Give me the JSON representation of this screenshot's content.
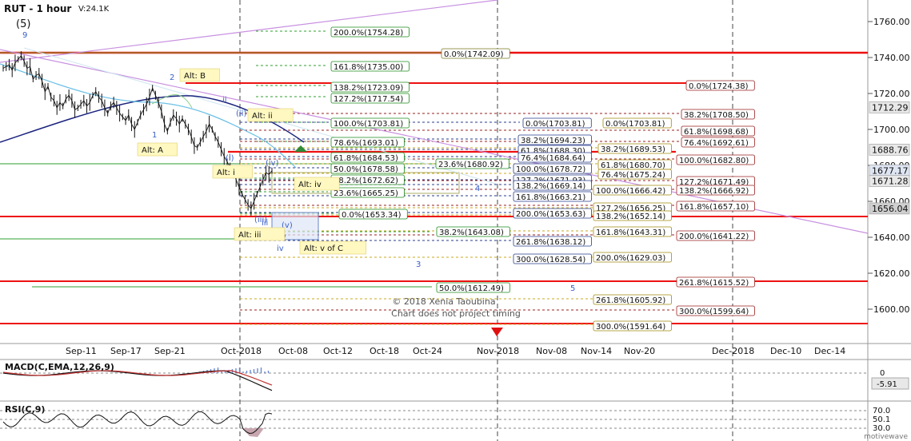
{
  "header": {
    "symbol": "RUT - 1 hour",
    "volume": "V:24.1K",
    "wave_label": "(5)"
  },
  "chart_data": {
    "type": "line",
    "title": "RUT - 1 hour",
    "y_axis_ticks": [
      1600,
      1620,
      1640,
      1660,
      1680,
      1700,
      1720,
      1740,
      1760
    ],
    "y_axis_tick_labels": [
      "1600.00",
      "1620.00",
      "1640.00",
      "1660.00",
      "1680.00",
      "1700.00",
      "1720.00",
      "1740.00",
      "1760.00"
    ],
    "ylim": [
      1583,
      1772
    ],
    "x_tick_labels": [
      "Sep-11",
      "Sep-17",
      "Sep-21",
      "Oct-2018",
      "Oct-08",
      "Oct-12",
      "Oct-18",
      "Oct-24",
      "Nov-2018",
      "Nov-08",
      "Nov-14",
      "Nov-20",
      "Dec-2018",
      "Dec-10",
      "Dec-14"
    ],
    "price_badges": [
      {
        "value": 1712.29,
        "label": "1712.29",
        "bg": "#e8e8e8"
      },
      {
        "value": 1688.76,
        "label": "1688.76",
        "bg": "#e8e8e8"
      },
      {
        "value": 1677.17,
        "label": "1677.17",
        "bg": "#dfe6f3"
      },
      {
        "value": 1671.28,
        "label": "1671.28",
        "bg": "#e8e8e8"
      },
      {
        "value": 1656.04,
        "label": "1656.04",
        "bg": "#cfcfcf"
      }
    ],
    "close_series": [
      1734,
      1735,
      1736,
      1733,
      1737,
      1739,
      1741,
      1738,
      1734,
      1735,
      1728,
      1730,
      1731,
      1727,
      1721,
      1724,
      1718,
      1716,
      1712,
      1715,
      1713,
      1717,
      1719,
      1716,
      1711,
      1712,
      1714,
      1716,
      1713,
      1715,
      1719,
      1721,
      1718,
      1716,
      1712,
      1709,
      1713,
      1715,
      1712,
      1709,
      1707,
      1705,
      1708,
      1703,
      1700,
      1704,
      1708,
      1711,
      1714,
      1718,
      1723,
      1719,
      1715,
      1710,
      1703,
      1699,
      1704,
      1708,
      1706,
      1703,
      1706,
      1703,
      1700,
      1696,
      1691,
      1690,
      1693,
      1696,
      1699,
      1703,
      1700,
      1696,
      1693,
      1689,
      1685,
      1682,
      1679,
      1676,
      1672,
      1668,
      1664,
      1661,
      1658,
      1656,
      1660,
      1664,
      1668,
      1672,
      1676,
      1675,
      1677
    ],
    "fib_labels": [
      {
        "text": "200.0%(1754.28)",
        "color": "#1e8c1e"
      },
      {
        "text": "161.8%(1735.00)",
        "color": "#1e8c1e"
      },
      {
        "text": "138.2%(1723.09)",
        "color": "#1e8c1e"
      },
      {
        "text": "127.2%(1717.54)",
        "color": "#1e8c1e"
      },
      {
        "text": "100.0%(1703.81)",
        "color": "#1e8c1e"
      },
      {
        "text": "78.6%(1693.01)",
        "color": "#1e8c1e"
      },
      {
        "text": "61.8%(1684.53)",
        "color": "#1e8c1e"
      },
      {
        "text": "50.0%(1678.58)",
        "color": "#1e8c1e"
      },
      {
        "text": "38.2%(1672.62)",
        "color": "#1e8c1e"
      },
      {
        "text": "23.6%(1665.25)",
        "color": "#1e8c1e"
      },
      {
        "text": "0.0%(1653.34)",
        "color": "#1e8c1e"
      },
      {
        "text": "38.2%(1643.08)",
        "color": "#1e8c1e"
      },
      {
        "text": "50.0%(1612.49)",
        "color": "#1e8c1e"
      },
      {
        "text": "0.0%(1742.09)",
        "color": "#7a7a20"
      },
      {
        "text": "23.6%(1680.92)",
        "color": "#1e8c1e"
      },
      {
        "text": "0.0%(1703.81)",
        "color": "#283c8c"
      },
      {
        "text": "38.2%(1694.23)",
        "color": "#283c8c"
      },
      {
        "text": "61.8%(1688.30)",
        "color": "#283c8c"
      },
      {
        "text": "76.4%(1684.64)",
        "color": "#283c8c"
      },
      {
        "text": "100.0%(1678.72)",
        "color": "#283c8c"
      },
      {
        "text": "127.2%(1671.93)",
        "color": "#283c8c"
      },
      {
        "text": "138.2%(1669.14)",
        "color": "#283c8c"
      },
      {
        "text": "161.8%(1663.21)",
        "color": "#283c8c"
      },
      {
        "text": "200.0%(1653.63)",
        "color": "#283c8c"
      },
      {
        "text": "261.8%(1638.12)",
        "color": "#283c8c"
      },
      {
        "text": "300.0%(1628.54)",
        "color": "#283c8c"
      },
      {
        "text": "0.0%(1703.81)",
        "color": "#a08a10"
      },
      {
        "text": "38.2%(1689.53)",
        "color": "#a08a10"
      },
      {
        "text": "61.8%(1680.70)",
        "color": "#a08a10"
      },
      {
        "text": "76.4%(1675.24)",
        "color": "#a08a10"
      },
      {
        "text": "100.0%(1666.42)",
        "color": "#a08a10"
      },
      {
        "text": "127.2%(1656.25)",
        "color": "#a08a10"
      },
      {
        "text": "138.2%(1652.14)",
        "color": "#a08a10"
      },
      {
        "text": "161.8%(1643.31)",
        "color": "#a08a10"
      },
      {
        "text": "200.0%(1629.03)",
        "color": "#a08a10"
      },
      {
        "text": "261.8%(1605.92)",
        "color": "#a08a10"
      },
      {
        "text": "300.0%(1591.64)",
        "color": "#a08a10"
      },
      {
        "text": "0.0%(1724.38)",
        "color": "#9a2020"
      },
      {
        "text": "38.2%(1708.50)",
        "color": "#9a2020"
      },
      {
        "text": "61.8%(1698.68)",
        "color": "#9a2020"
      },
      {
        "text": "76.4%(1692.61)",
        "color": "#9a2020"
      },
      {
        "text": "100.0%(1682.80)",
        "color": "#9a2020"
      },
      {
        "text": "127.2%(1671.49)",
        "color": "#9a2020"
      },
      {
        "text": "138.2%(1666.92)",
        "color": "#9a2020"
      },
      {
        "text": "161.8%(1657.10)",
        "color": "#9a2020"
      },
      {
        "text": "200.0%(1641.22)",
        "color": "#9a2020"
      },
      {
        "text": "261.8%(1615.52)",
        "color": "#9a2020"
      },
      {
        "text": "300.0%(1599.64)",
        "color": "#9a2020"
      }
    ],
    "wave_labels": [
      "9",
      "2",
      "1",
      "(i)",
      "(ii)",
      "(iii)",
      "(iv)",
      "(v)",
      "ii",
      "i",
      "iii",
      "iv",
      "v",
      "3",
      "4",
      "5"
    ],
    "annotations": [
      "Alt: B",
      "Alt: A",
      "Alt: ii",
      "Alt: i",
      "Alt: iv",
      "Alt: iii",
      "Alt: v of C"
    ],
    "watermark": [
      "© 2018 Xenia Taoubina",
      "Chart does not project timing"
    ],
    "line_colors": {
      "support": "#ee1111",
      "fib_green": "#1e8c1e",
      "fib_blue": "#283c8c",
      "fib_gold": "#a08a10",
      "fib_maroon": "#9a2020",
      "ma_slow": "#1a237e",
      "ma_fast": "#6cc0e6",
      "trend": "#c890e0"
    }
  },
  "macd": {
    "label": "MACD(C,EMA,12,26,9)",
    "value": "-5.91",
    "ticks": [
      "0"
    ]
  },
  "rsi": {
    "label": "RSI(C,9)",
    "ticks": [
      "70.0",
      "50.1",
      "30.0"
    ]
  },
  "footer": {
    "brand": "motivewave"
  }
}
